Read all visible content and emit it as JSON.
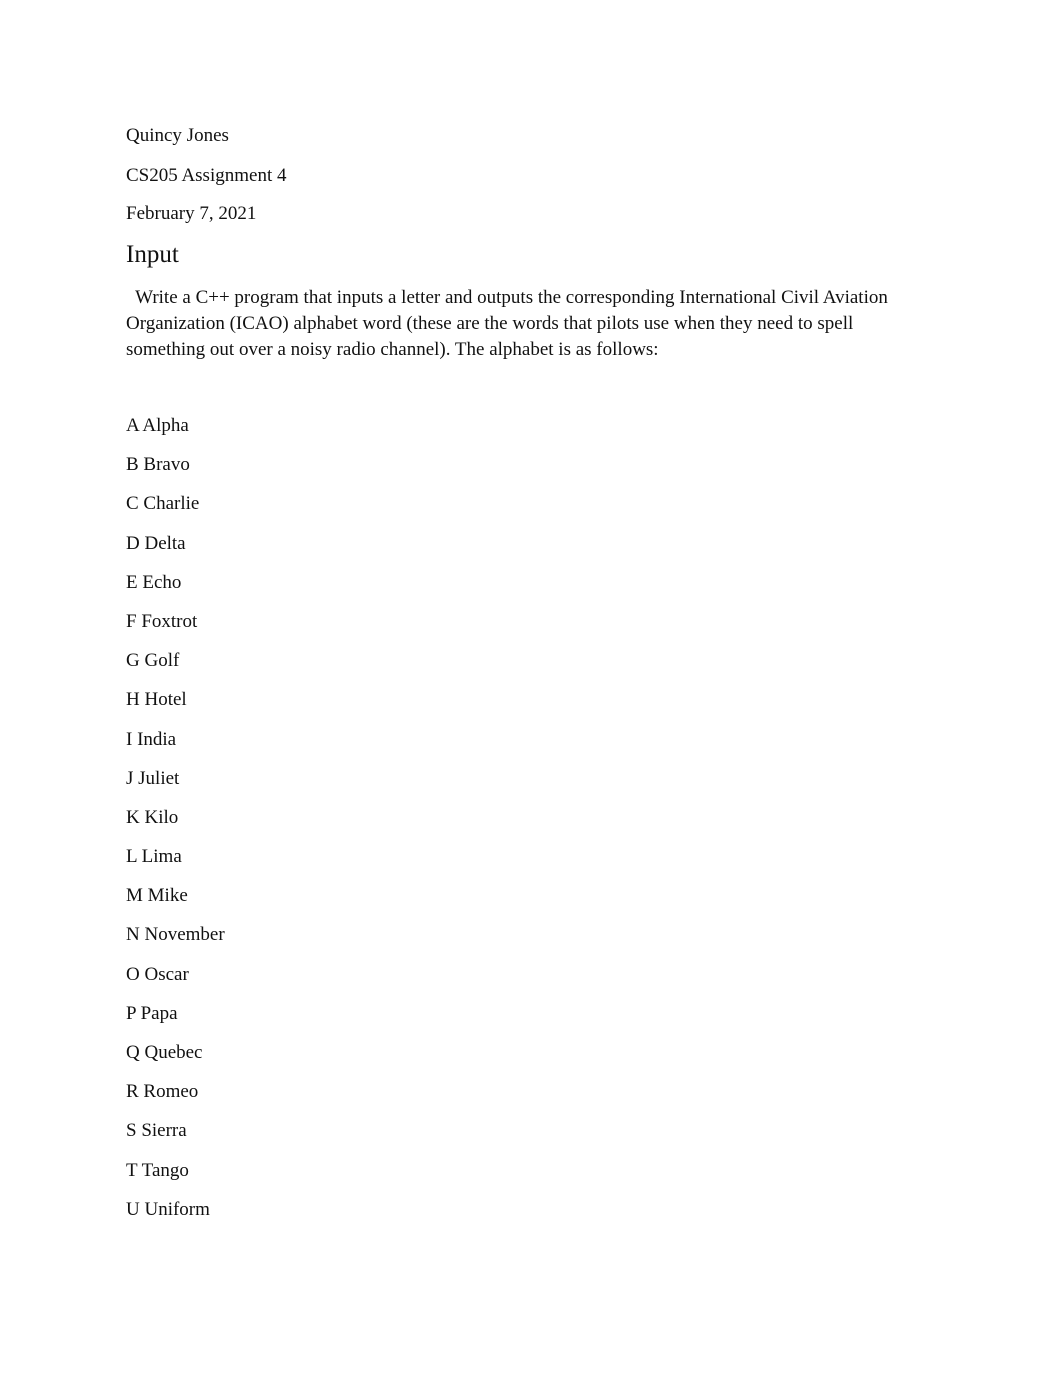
{
  "header": {
    "author": "Quincy Jones",
    "course": "CS205 Assignment 4",
    "date": "February 7, 2021"
  },
  "section": {
    "heading": "Input",
    "paragraph_lines": [
      "  Write a C++ program that inputs a letter and outputs the corresponding International Civil Aviation",
      "Organization (ICAO) alphabet word (these are the words that pilots use when they need to spell",
      "something out over a noisy radio channel). The alphabet is as follows:"
    ]
  },
  "alphabet": [
    "A Alpha",
    "B Bravo",
    "C Charlie",
    "D Delta",
    "E Echo",
    "F Foxtrot",
    "G Golf",
    "H Hotel",
    "I India",
    "J Juliet",
    "K Kilo",
    "L Lima",
    "M Mike",
    "N November",
    "O Oscar",
    "P Papa",
    "Q Quebec",
    "R Romeo",
    "S Sierra",
    "T Tango",
    "U Uniform"
  ]
}
